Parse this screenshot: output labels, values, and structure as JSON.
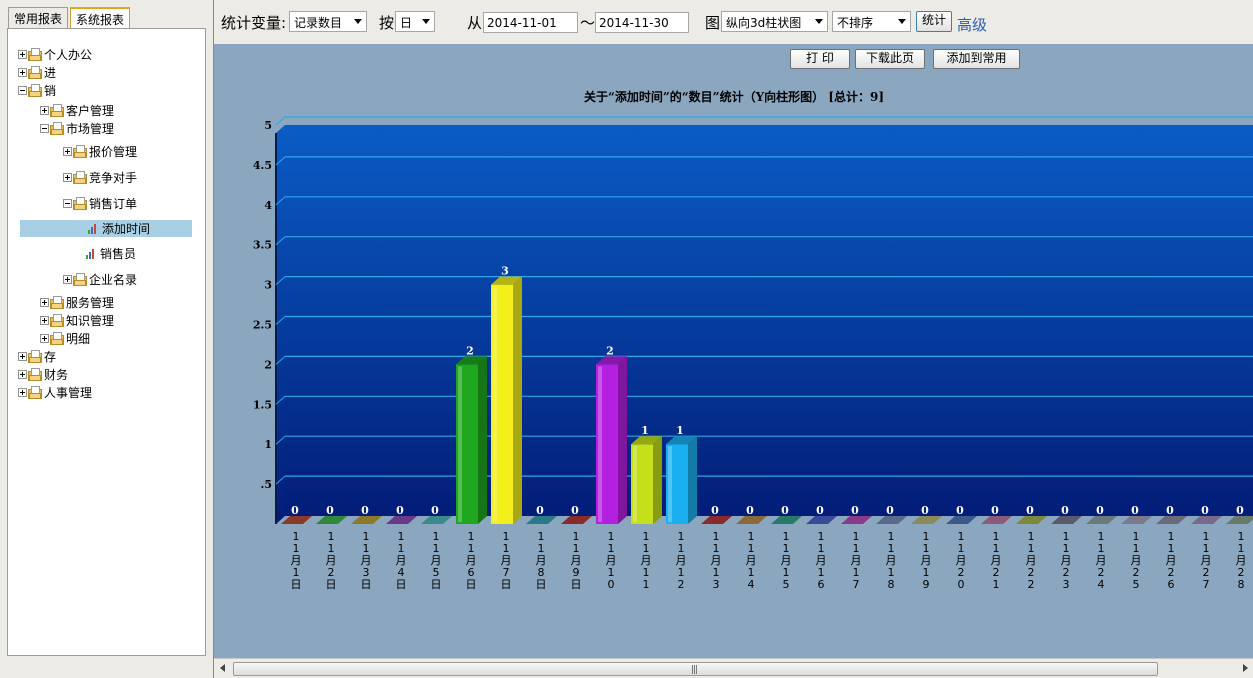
{
  "left_panel": {
    "tabs": [
      {
        "label": "常用报表",
        "active": false
      },
      {
        "label": "系统报表",
        "active": true
      }
    ],
    "tree": [
      {
        "label": "个人办公",
        "level": 0,
        "expand": "plus",
        "icon": "folder"
      },
      {
        "label": "进",
        "level": 0,
        "expand": "plus",
        "icon": "folder"
      },
      {
        "label": "销",
        "level": 0,
        "expand": "minus",
        "icon": "folder"
      },
      {
        "label": "客户管理",
        "level": 1,
        "expand": "plus",
        "icon": "folder"
      },
      {
        "label": "市场管理",
        "level": 1,
        "expand": "minus",
        "icon": "folder"
      },
      {
        "label": "报价管理",
        "level": 2,
        "expand": "plus",
        "icon": "folder"
      },
      {
        "label": "竞争对手",
        "level": 2,
        "expand": "plus",
        "icon": "folder"
      },
      {
        "label": "销售订单",
        "level": 2,
        "expand": "minus",
        "icon": "folder"
      },
      {
        "label": "添加时间",
        "level": 3,
        "expand": "none",
        "icon": "chart",
        "selected": true
      },
      {
        "label": "销售员",
        "level": 3,
        "expand": "none",
        "icon": "chart"
      },
      {
        "label": "企业名录",
        "level": 2,
        "expand": "plus",
        "icon": "folder"
      },
      {
        "label": "服务管理",
        "level": 1,
        "expand": "plus",
        "icon": "folder"
      },
      {
        "label": "知识管理",
        "level": 1,
        "expand": "plus",
        "icon": "folder"
      },
      {
        "label": "明细",
        "level": 1,
        "expand": "plus",
        "icon": "folder"
      },
      {
        "label": "存",
        "level": 0,
        "expand": "plus",
        "icon": "folder"
      },
      {
        "label": "财务",
        "level": 0,
        "expand": "plus",
        "icon": "folder"
      },
      {
        "label": "人事管理",
        "level": 0,
        "expand": "plus",
        "icon": "folder"
      }
    ]
  },
  "toolbar": {
    "stat_var_label": "统计变量:",
    "stat_var_value": "记录数目",
    "by_label": "按",
    "by_value": "日",
    "from_label": "从",
    "date_from": "2014-11-01",
    "tilde": "～",
    "date_to": "2014-11-30",
    "chart_label": "图",
    "chart_type_value": "纵向3d柱状图",
    "sort_value": "不排序",
    "stat_button": "统计",
    "advanced_link": "高级"
  },
  "actions": {
    "print": "打 印",
    "download": "下载此页",
    "add_common": "添加到常用"
  },
  "chart_data": {
    "type": "bar",
    "title": "关于“添加时间”的“数目”统计（Y向柱形图） [总计：9]",
    "categories": [
      "11月1日",
      "11月2日",
      "11月3日",
      "11月4日",
      "11月5日",
      "11月6日",
      "11月7日",
      "11月8日",
      "11月9日",
      "11月10日",
      "11月11日",
      "11月12日",
      "11月13日",
      "11月14日",
      "11月15日",
      "11月16日",
      "11月17日",
      "11月18日",
      "11月19日",
      "11月20日",
      "11月21日",
      "11月22日",
      "11月23日",
      "11月24日",
      "11月25日",
      "11月26日",
      "11月27日",
      "11月28日"
    ],
    "values": [
      0,
      0,
      0,
      0,
      0,
      2,
      3,
      0,
      0,
      2,
      1,
      1,
      0,
      0,
      0,
      0,
      0,
      0,
      0,
      0,
      0,
      0,
      0,
      0,
      0,
      0,
      0,
      0
    ],
    "ytick_labels": [
      ".5",
      "1",
      "1.5",
      "2",
      "2.5",
      "3",
      "3.5",
      "4",
      "4.5",
      "5"
    ],
    "ylim": [
      0,
      5
    ],
    "bar_colors": [
      "#8a3a2a",
      "#2e8a3a",
      "#8a7a2a",
      "#6a3a8a",
      "#3a8a8a",
      "#1fa81f",
      "#f2ef1a",
      "#2a7a8a",
      "#8a2a2a",
      "#b520e0",
      "#c5e01a",
      "#1ab0f0",
      "#8a2a2a",
      "#8a6a3a",
      "#2a7a6a",
      "#3a4a9a",
      "#8a3a8a",
      "#5a6a8a",
      "#8a8a5a",
      "#3a5a8a",
      "#8a5a7a",
      "#7a8a3a",
      "#5a5a6a",
      "#6a7a7a",
      "#7a7a8a",
      "#6a6a7a",
      "#7a6a8a",
      "#6a7a6a"
    ]
  }
}
